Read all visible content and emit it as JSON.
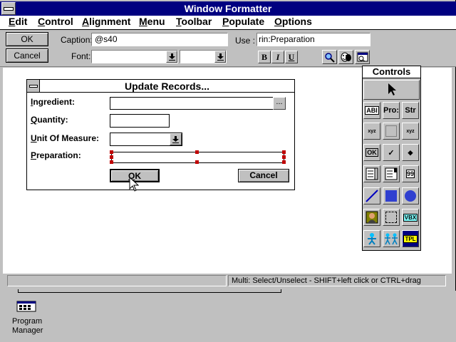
{
  "window": {
    "title": "Window Formatter",
    "sysmenu_glyph": "—"
  },
  "menu": {
    "items": [
      {
        "label": "Edit",
        "ul": "E",
        "rest": "dit"
      },
      {
        "label": "Control",
        "ul": "C",
        "rest": "ontrol"
      },
      {
        "label": "Alignment",
        "ul": "A",
        "rest": "lignment"
      },
      {
        "label": "Menu",
        "ul": "M",
        "rest": "enu"
      },
      {
        "label": "Toolbar",
        "ul": "T",
        "rest": "oolbar"
      },
      {
        "label": "Populate",
        "ul": "P",
        "rest": "opulate"
      },
      {
        "label": "Options",
        "ul": "O",
        "rest": "ptions"
      }
    ]
  },
  "toolbar": {
    "ok_label": "OK",
    "cancel_label": "Cancel",
    "caption_label": "Caption:",
    "caption_value": "@s40",
    "use_label": "Use :",
    "use_value": "rin:Preparation",
    "font_label": "Font:",
    "bold_glyph": "B",
    "italic_glyph": "I",
    "underline_glyph": "U"
  },
  "dialog": {
    "title": "Update Records...",
    "ingredient_label": "Ingredient:",
    "ingredient_ul": "I",
    "ingredient_rest": "ngredient:",
    "quantity_label": "Quantity:",
    "quantity_ul": "Q",
    "quantity_rest": "uantity:",
    "unit_label": "Unit Of Measure:",
    "unit_ul": "U",
    "unit_rest": "nit Of Measure:",
    "prep_label": "Preparation:",
    "prep_ul": "P",
    "prep_rest": "reparation:",
    "ellipsis": "...",
    "ok_label": "OK",
    "ok_ul": "O",
    "ok_rest": "K",
    "cancel_label": "Cancel"
  },
  "controls": {
    "title": "Controls",
    "cells": [
      "ABI",
      "Pro:",
      "Str",
      "xyz",
      "",
      "xyz",
      "OK",
      "✓",
      "◆",
      "",
      "",
      "99",
      "",
      "",
      "",
      "",
      "",
      "VBX",
      "",
      "",
      "TPL"
    ]
  },
  "status": {
    "text": "Multi: Select/Unselect - SHIFT+left click or CTRL+drag"
  },
  "desktop": {
    "icon_label_1": "Program",
    "icon_label_2": "Manager"
  }
}
